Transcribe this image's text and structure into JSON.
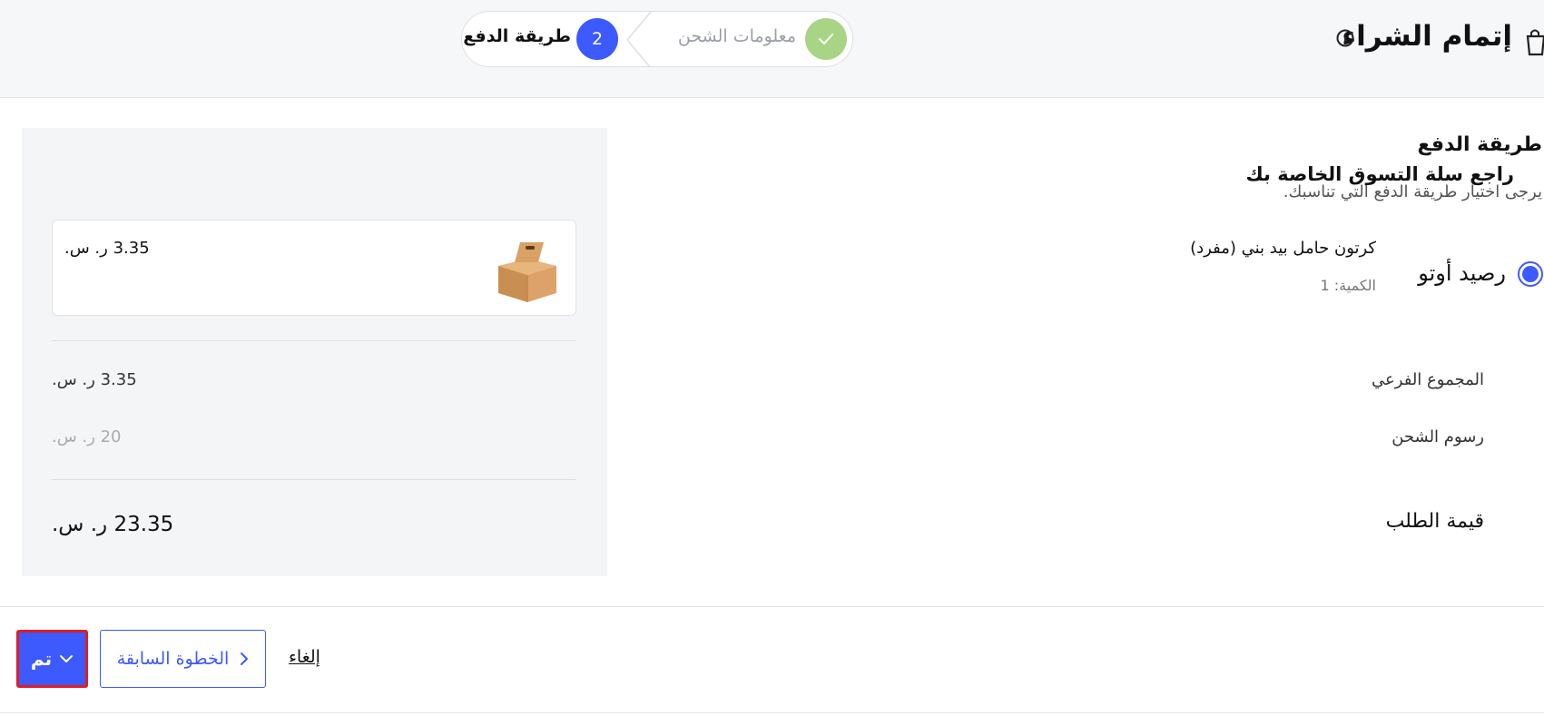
{
  "header": {
    "title": "إتمام الشراء",
    "icons": {
      "cart": "shopping-bag-icon",
      "info": "info-icon"
    },
    "steps": [
      {
        "label": "معلومات الشحن",
        "status": "completed",
        "icon": "check-icon"
      },
      {
        "label": "طريقة الدفع",
        "number": "2",
        "status": "active"
      }
    ]
  },
  "payment": {
    "title": "طريقة الدفع",
    "subtitle": "يرجى اختيار طريقة الدفع التي تناسبك.",
    "option": {
      "label": "رصيد أوتو",
      "selected": true
    }
  },
  "summary": {
    "title": "راجع سلة التسوق الخاصة بك",
    "item": {
      "name": "كرتون حامل بيد بني (مفرد)",
      "quantity": "الكمية: 1",
      "price": "3.35 ر. س.",
      "image": "cardboard-box-image"
    },
    "subtotal_label": "المجموع الفرعي",
    "subtotal_value": "3.35 ر. س.",
    "shipping_label": "رسوم الشحن",
    "shipping_value": "20 ر. س.",
    "total_label": "قيمة الطلب",
    "total_value": "23.35 ر. س."
  },
  "footer": {
    "done_label": "تم",
    "prev_label": "الخطوة السابقة",
    "cancel_label": "إلغاء"
  },
  "colors": {
    "accent": "#3d5afe",
    "completed_step": "#a8d485",
    "highlight_border": "#e31b23",
    "panel_bg": "#f4f5f7"
  }
}
